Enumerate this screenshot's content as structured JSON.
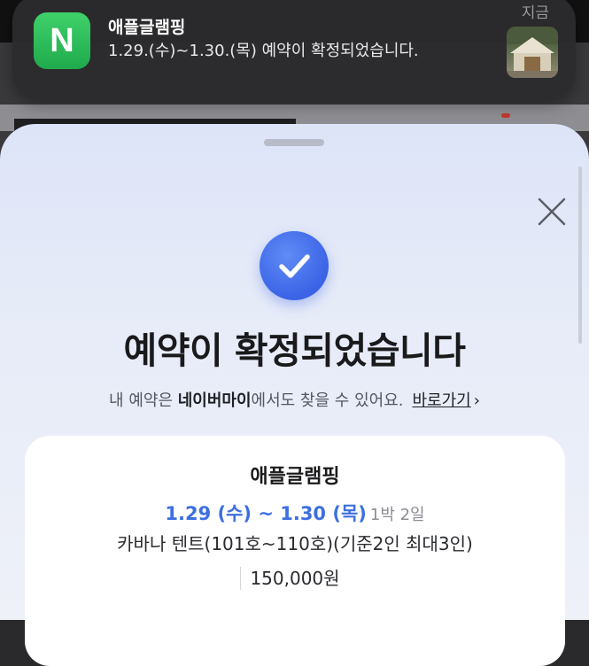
{
  "notification": {
    "app_icon_letter": "N",
    "title": "애플글램핑",
    "body": "1.29.(수)~1.30.(목) 예약이 확정되었습니다.",
    "time": "지금",
    "thumbnail_icon": "glamping-tent-photo"
  },
  "sheet": {
    "close_icon": "close-icon",
    "check_icon": "check-icon",
    "headline": "예약이 확정되었습니다",
    "sub_prefix": "내 예약은 ",
    "sub_bold": "네이버마이",
    "sub_suffix": "에서도 찾을 수 있어요.",
    "link_label": "바로가기",
    "link_chevron": "›"
  },
  "reservation": {
    "place_name": "애플글램핑",
    "date_range": "1.29 (수) ~ 1.30 (목)",
    "nights": "1박 2일",
    "room": "카바나 텐트(101호~110호)(기준2인 최대3인)",
    "price": "150,000원"
  },
  "colors": {
    "accent": "#3d6fe0",
    "check_bg": "#3b63e6",
    "naver_green": "#1faa4c",
    "sheet_bg": "#e3e9f8"
  }
}
